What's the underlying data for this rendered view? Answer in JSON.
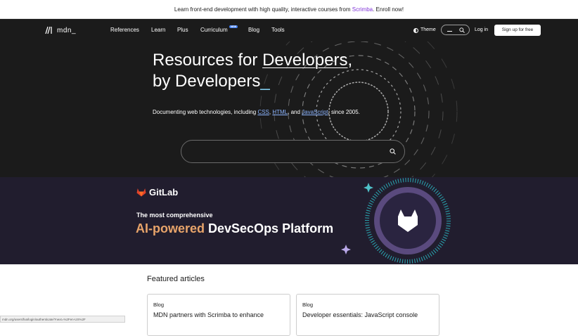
{
  "banner": {
    "text_before": "Learn front-end development with high quality, interactive courses from ",
    "link": "Scrimba",
    "text_after": ". Enroll now!"
  },
  "nav": {
    "logo_text": "mdn",
    "logo_cursor": "_",
    "items": [
      "References",
      "Learn",
      "Plus",
      "Curriculum",
      "Blog",
      "Tools"
    ],
    "new_badge": "NEW",
    "theme_label": "Theme",
    "search_value": "_",
    "login": "Log in",
    "signup": "Sign up for free"
  },
  "hero": {
    "title_prefix": "Resources for ",
    "title_link": "Developers",
    "title_comma": ",",
    "title_line2": "by Developers",
    "title_cursor": "_",
    "sub_prefix": "Documenting web technologies, including ",
    "sub_css": "CSS",
    "sub_sep1": ", ",
    "sub_html": "HTML",
    "sub_sep2": ", and ",
    "sub_js": "JavaScript",
    "sub_suffix": ", since 2005.",
    "search_placeholder": ""
  },
  "ad": {
    "brand": "GitLab",
    "line1": "The most comprehensive",
    "line2_highlight": "AI-powered",
    "line2_rest": " DevSecOps Platform",
    "accent_color": "#e8a46a",
    "bg_color": "#211d2e"
  },
  "featured": {
    "heading": "Featured articles",
    "cards": [
      {
        "tag": "Blog",
        "title": "MDN partners with Scrimba to enhance"
      },
      {
        "tag": "Blog",
        "title": "Developer essentials: JavaScript console"
      }
    ]
  },
  "status_url": "mdn.org/users/fxa/login/authenticate/?next=%2Fen-US%2F"
}
